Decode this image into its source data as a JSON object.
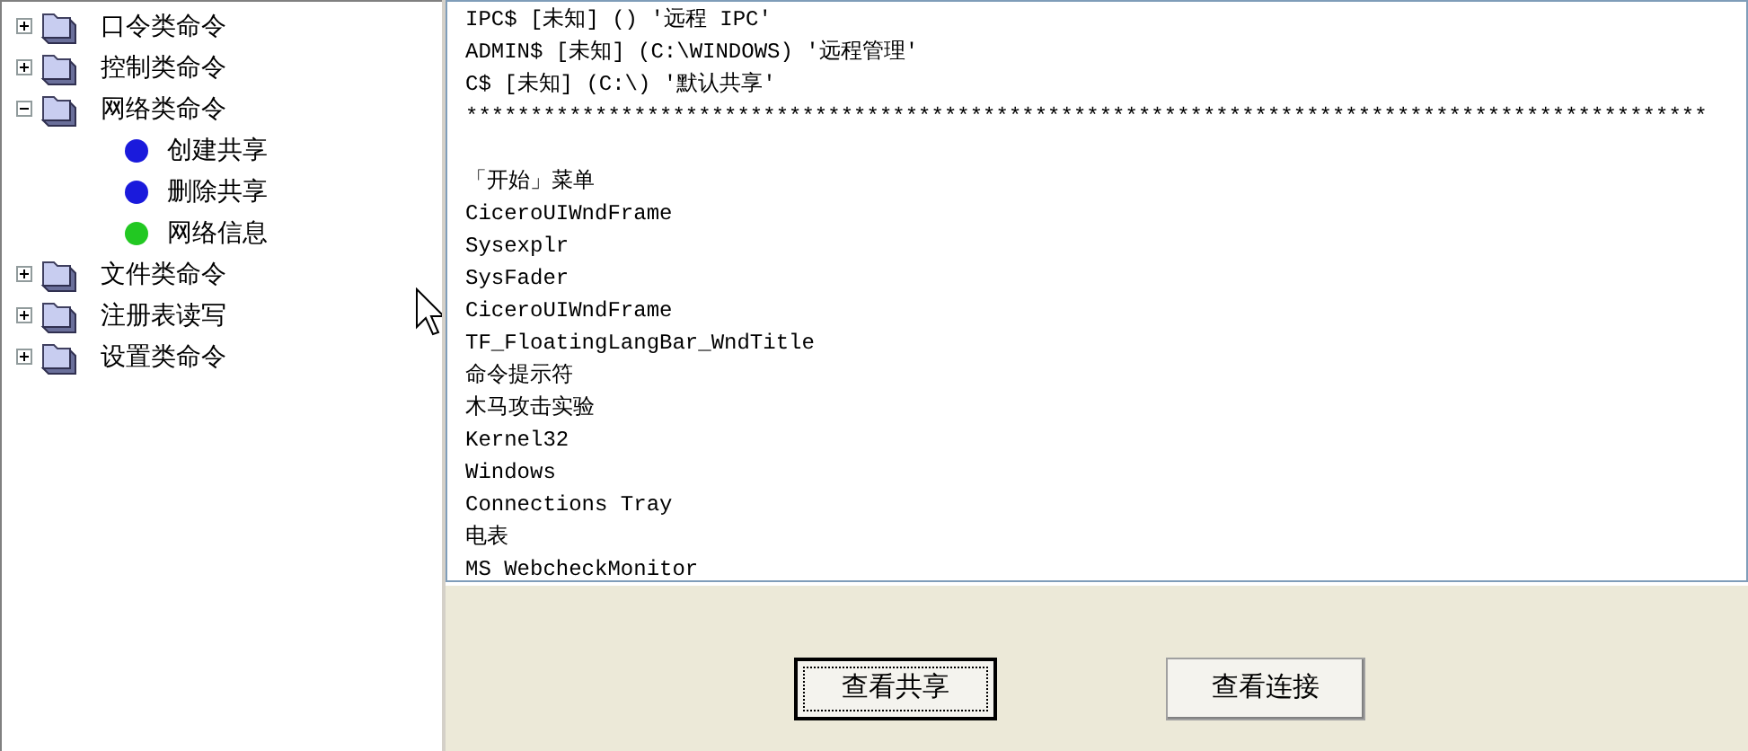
{
  "tree": [
    {
      "label": "口令类命令",
      "expanded": false
    },
    {
      "label": "控制类命令",
      "expanded": false
    },
    {
      "label": "网络类命令",
      "expanded": true,
      "children": [
        {
          "label": "创建共享",
          "color": "#1a1adc"
        },
        {
          "label": "删除共享",
          "color": "#1a1adc"
        },
        {
          "label": "网络信息",
          "color": "#22c822"
        }
      ]
    },
    {
      "label": "文件类命令",
      "expanded": false
    },
    {
      "label": "注册表读写",
      "expanded": false
    },
    {
      "label": "设置类命令",
      "expanded": false
    }
  ],
  "output_lines": [
    "IPC$ [未知] () '远程 IPC'",
    "ADMIN$ [未知] (C:\\WINDOWS) '远程管理'",
    "C$ [未知] (C:\\) '默认共享'",
    {
      "kind": "separator",
      "text": "************************************************************************************************"
    },
    "「开始」菜单",
    "CiceroUIWndFrame",
    "Sysexplr",
    "SysFader",
    "CiceroUIWndFrame",
    "TF_FloatingLangBar_WndTitle",
    "命令提示符",
    "木马攻击实验",
    "Kernel32",
    "Windows",
    "Connections Tray",
    "电表",
    "MS WebcheckMonitor"
  ],
  "buttons": [
    {
      "label": "查看共享",
      "focused": true
    },
    {
      "label": "查看连接",
      "focused": false
    }
  ]
}
